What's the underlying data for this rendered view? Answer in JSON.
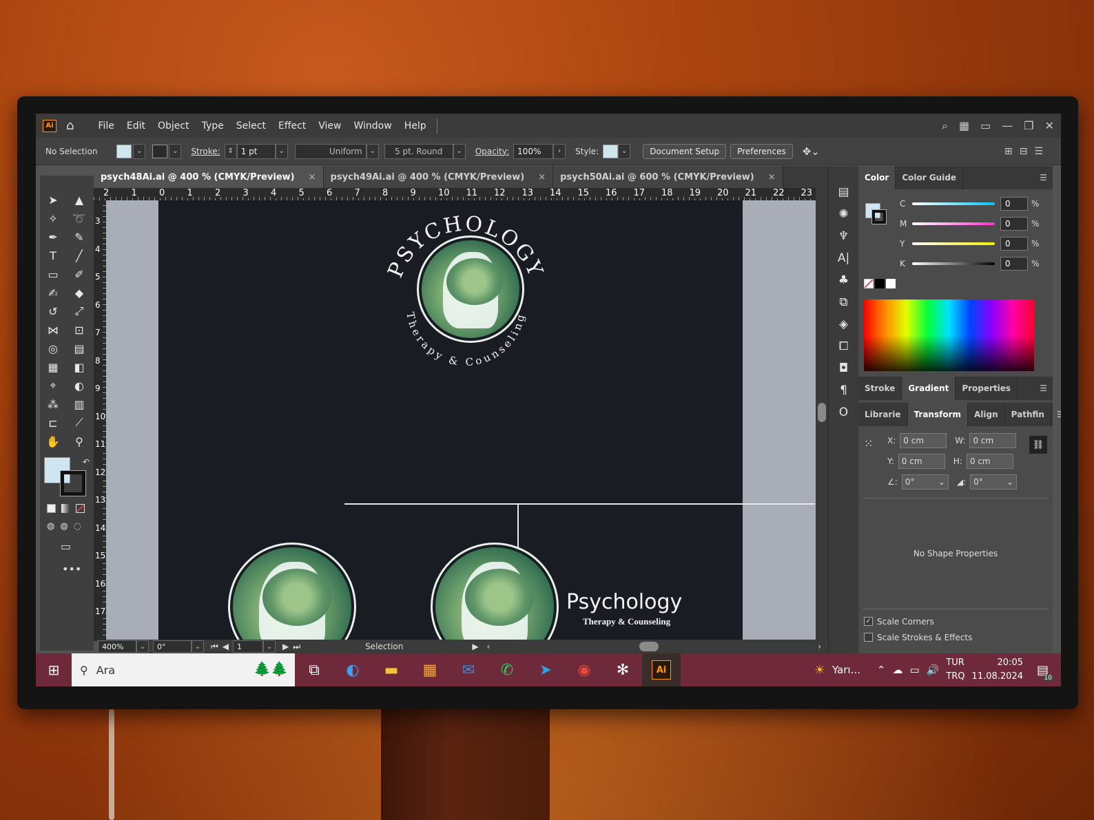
{
  "app": {
    "logo": "Ai"
  },
  "menu": [
    "File",
    "Edit",
    "Object",
    "Type",
    "Select",
    "Effect",
    "View",
    "Window",
    "Help"
  ],
  "control": {
    "selection_status": "No Selection",
    "stroke_label": "Stroke:",
    "stroke_weight": "1 pt",
    "profile": "Uniform",
    "brush": "5 pt. Round",
    "opacity_label": "Opacity:",
    "opacity": "100%",
    "style_label": "Style:",
    "document_setup": "Document Setup",
    "preferences": "Preferences"
  },
  "tabs": [
    {
      "label": "psych48Ai.ai @ 400 % (CMYK/Preview)",
      "close": "×"
    },
    {
      "label": "psych49Ai.ai @ 400 % (CMYK/Preview)",
      "close": "×"
    },
    {
      "label": "psych50Ai.ai @ 600 % (CMYK/Preview)",
      "close": "×"
    }
  ],
  "ruler_top": [
    "2",
    "1",
    "0",
    "1",
    "2",
    "3",
    "4",
    "5",
    "6",
    "7",
    "8",
    "9",
    "10",
    "11",
    "12",
    "13",
    "14",
    "15",
    "16",
    "17",
    "18",
    "19",
    "20",
    "21",
    "22",
    "23"
  ],
  "ruler_left": [
    "3",
    "4",
    "5",
    "6",
    "7",
    "8",
    "9",
    "10",
    "11",
    "12",
    "13",
    "14",
    "15",
    "16",
    "17"
  ],
  "artwork": {
    "arc_top": "PSYCHOLOGY",
    "arc_bottom": "Therapy & Counseling",
    "title": "Psychology",
    "subtitle": "Therapy & Counseling"
  },
  "status": {
    "zoom": "400%",
    "rotation": "0°",
    "artboard": "1",
    "tool": "Selection"
  },
  "color_panel": {
    "tabs": [
      "Color",
      "Color Guide"
    ],
    "sliders": [
      {
        "label": "C",
        "value": "0",
        "unit": "%",
        "color": "#00c8ff"
      },
      {
        "label": "M",
        "value": "0",
        "unit": "%",
        "color": "#ff2fd0"
      },
      {
        "label": "Y",
        "value": "0",
        "unit": "%",
        "color": "#f2f000"
      },
      {
        "label": "K",
        "value": "0",
        "unit": "%",
        "color": "#000000"
      }
    ]
  },
  "panel_tabs_2": [
    "Stroke",
    "Gradient",
    "Properties"
  ],
  "panel_tabs_3": [
    "Librarie",
    "Transform",
    "Align",
    "Pathfin"
  ],
  "transform": {
    "x_label": "X:",
    "x": "0 cm",
    "w_label": "W:",
    "w": "0 cm",
    "y_label": "Y:",
    "y": "0 cm",
    "h_label": "H:",
    "h": "0 cm",
    "angle": "0°",
    "shear": "0°",
    "empty_message": "No Shape Properties",
    "scale_corners": "Scale Corners",
    "scale_strokes": "Scale Strokes & Effects"
  },
  "taskbar": {
    "search_placeholder": "Ara",
    "weather": "Yarı...",
    "lang1": "TUR",
    "lang2": "TRQ",
    "time": "20:05",
    "date": "11.08.2024",
    "notifications": "10"
  }
}
